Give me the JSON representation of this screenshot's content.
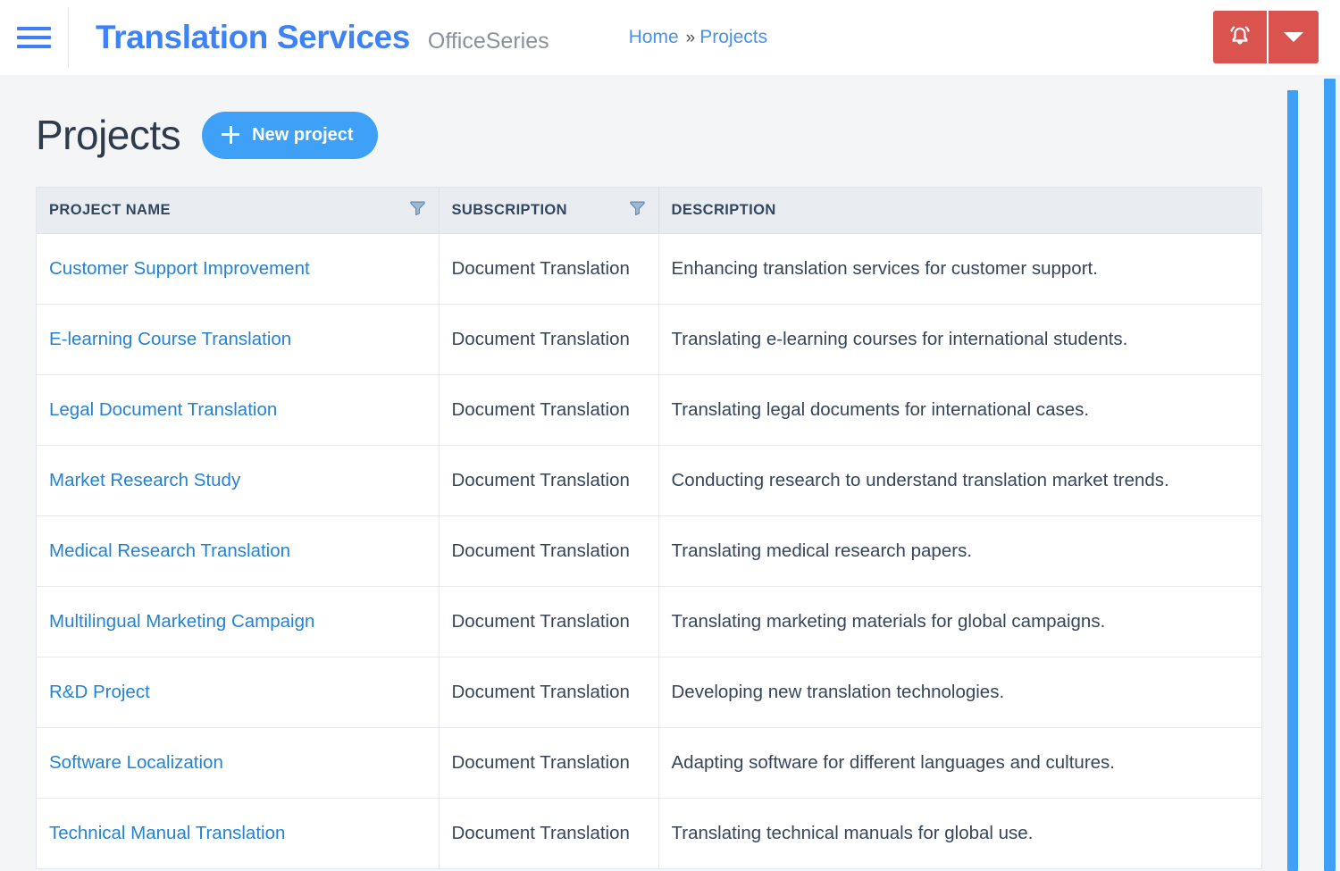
{
  "navbar": {
    "menu_icon": "hamburger-icon",
    "brand_title": "Translation Services",
    "brand_subtitle": "OfficeSeries",
    "breadcrumb": {
      "home": "Home",
      "separator": "»",
      "current": "Projects"
    },
    "actions": {
      "alert_icon": "bell-icon",
      "caret_icon": "chevron-down-icon",
      "color": "#d9534f"
    }
  },
  "page": {
    "title": "Projects",
    "new_button": {
      "label": "New project",
      "icon": "plus-icon",
      "color": "#3fa0f7"
    }
  },
  "table": {
    "columns": [
      {
        "label": "PROJECT NAME",
        "filter": true
      },
      {
        "label": "SUBSCRIPTION",
        "filter": true
      },
      {
        "label": "DESCRIPTION",
        "filter": false
      }
    ],
    "rows": [
      {
        "name": "Customer Support Improvement",
        "subscription": "Document Translation",
        "description": "Enhancing translation services for customer support."
      },
      {
        "name": "E-learning Course Translation",
        "subscription": "Document Translation",
        "description": "Translating e-learning courses for international students."
      },
      {
        "name": "Legal Document Translation",
        "subscription": "Document Translation",
        "description": "Translating legal documents for international cases."
      },
      {
        "name": "Market Research Study",
        "subscription": "Document Translation",
        "description": "Conducting research to understand translation market trends."
      },
      {
        "name": "Medical Research Translation",
        "subscription": "Document Translation",
        "description": "Translating medical research papers."
      },
      {
        "name": "Multilingual Marketing Campaign",
        "subscription": "Document Translation",
        "description": "Translating marketing materials for global campaigns."
      },
      {
        "name": "R&D Project",
        "subscription": "Document Translation",
        "description": "Developing new translation technologies."
      },
      {
        "name": "Software Localization",
        "subscription": "Document Translation",
        "description": "Adapting software for different languages and cultures."
      },
      {
        "name": "Technical Manual Translation",
        "subscription": "Document Translation",
        "description": "Translating technical manuals for global use."
      }
    ]
  },
  "colors": {
    "brand_blue": "#3e82f7",
    "link_blue": "#2382d4",
    "accent_blue": "#3fa0f7",
    "alert_red": "#d9534f",
    "page_bg": "#f4f5f7",
    "header_bg": "#e9edf2"
  }
}
